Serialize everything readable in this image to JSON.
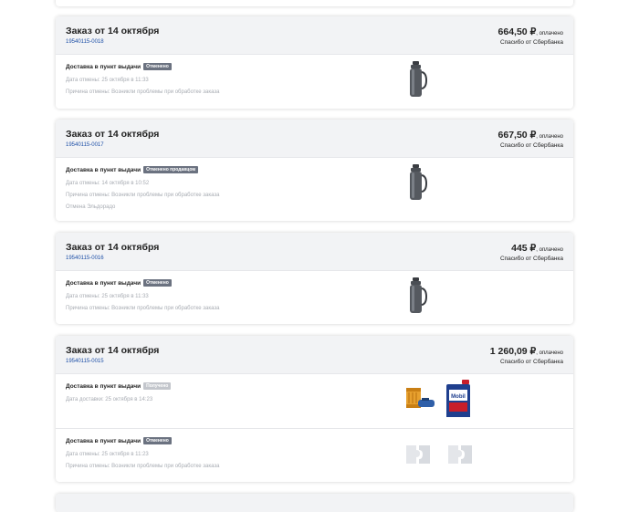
{
  "orders": [
    {
      "title": "Заказ от 14 октября",
      "number": "19540115-0018",
      "amount": "664,50 ₽",
      "paid": ", оплачено",
      "thanks": "Спасибо от Сбербанка",
      "sections": [
        {
          "delivery": "Доставка в пункт выдачи",
          "badge": "Отменено",
          "lines": [
            "Дата отмены: 25 октября в 11:33",
            "Причина отмены: Возникли проблемы при обработке заказа"
          ],
          "products": [
            "thermos-icon"
          ]
        }
      ]
    },
    {
      "title": "Заказ от 14 октября",
      "number": "19540115-0017",
      "amount": "667,50 ₽",
      "paid": ", оплачено",
      "thanks": "Спасибо от Сбербанка",
      "sections": [
        {
          "delivery": "Доставка в пункт выдачи",
          "badge": "Отменено продавцом",
          "lines": [
            "Дата отмены: 14 октября в 10:52",
            "Причина отмены: Возникли проблемы при обработке заказа",
            "Отмена Эльдорадо"
          ],
          "products": [
            "thermos-icon"
          ]
        }
      ]
    },
    {
      "title": "Заказ от 14 октября",
      "number": "19540115-0016",
      "amount": "445 ₽",
      "paid": ", оплачено",
      "thanks": "Спасибо от Сбербанка",
      "sections": [
        {
          "delivery": "Доставка в пункт выдачи",
          "badge": "Отменено",
          "lines": [
            "Дата отмены: 25 октября в 11:33",
            "Причина отмены: Возникли проблемы при обработке заказа"
          ],
          "products": [
            "thermos-icon"
          ]
        }
      ]
    },
    {
      "title": "Заказ от 14 октября",
      "number": "19540115-0015",
      "amount": "1 260,09 ₽",
      "paid": ", оплачено",
      "thanks": "Спасибо от Сбербанка",
      "sections": [
        {
          "delivery": "Доставка в пункт выдачи",
          "badge": "Получено",
          "lines": [
            "Дата доставки: 25 октября в 14:23"
          ],
          "products": [
            "oil-filter-icon",
            "motor-oil-can-icon"
          ]
        },
        {
          "delivery": "Доставка в пункт выдачи",
          "badge": "Отменено",
          "lines": [
            "Дата отмены: 25 октября в 11:23",
            "Причина отмены: Возникли проблемы при обработке заказа"
          ],
          "products": [
            "product-placeholder-icon",
            "product-placeholder-icon"
          ]
        }
      ]
    }
  ],
  "colors": {
    "order_number": "#1d4fa7",
    "badge_dark": "#6b7280",
    "badge_light": "#c3c6cc",
    "meta_text": "#a8acb3",
    "header_bg": "#f2f3f5"
  }
}
